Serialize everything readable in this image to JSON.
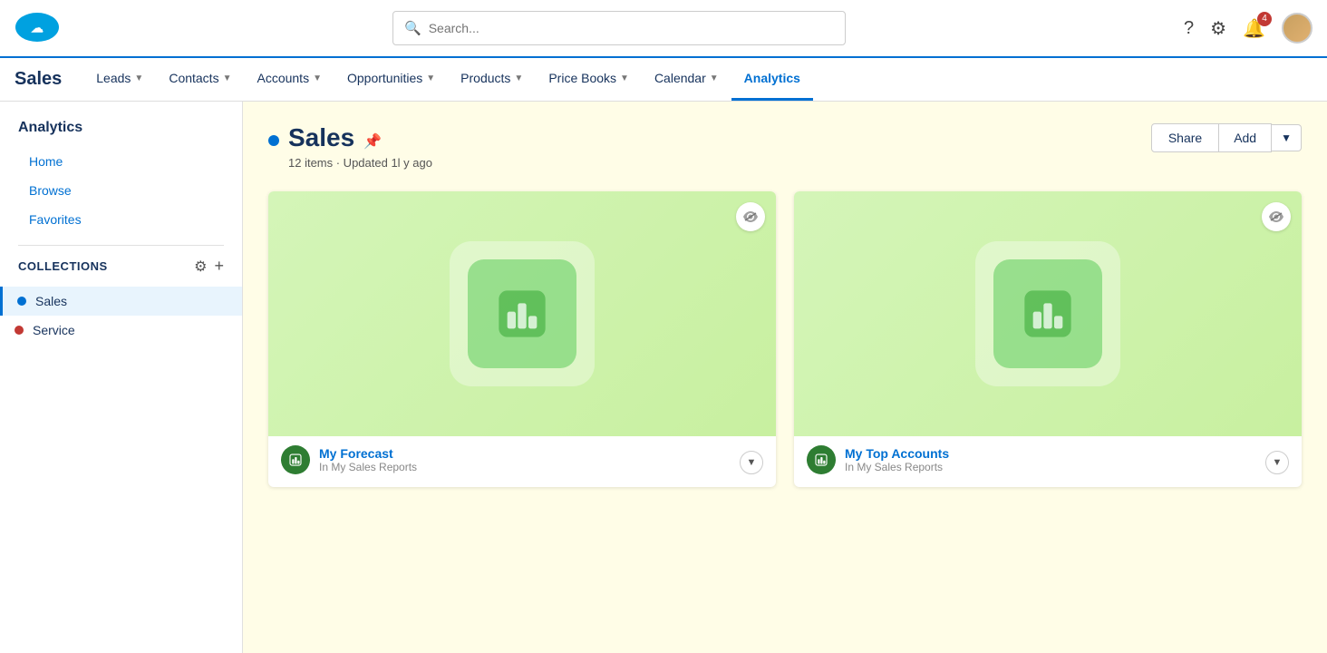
{
  "topbar": {
    "logo_alt": "Salesforce",
    "search_placeholder": "Search...",
    "help_icon": "?",
    "settings_icon": "⚙",
    "notifications_count": "4",
    "avatar_alt": "User Avatar"
  },
  "navbar": {
    "app_name": "Sales",
    "items": [
      {
        "label": "Leads",
        "active": false
      },
      {
        "label": "Contacts",
        "active": false
      },
      {
        "label": "Accounts",
        "active": false
      },
      {
        "label": "Opportunities",
        "active": false
      },
      {
        "label": "Products",
        "active": false
      },
      {
        "label": "Price Books",
        "active": false
      },
      {
        "label": "Calendar",
        "active": false
      },
      {
        "label": "Analytics",
        "active": true
      }
    ]
  },
  "sidebar": {
    "section_title": "Analytics",
    "nav_items": [
      {
        "label": "Home"
      },
      {
        "label": "Browse"
      },
      {
        "label": "Favorites"
      }
    ],
    "collections_title": "Collections",
    "collections": [
      {
        "label": "Sales",
        "color": "#0070d2",
        "active": true
      },
      {
        "label": "Service",
        "color": "#c23934",
        "active": false
      }
    ]
  },
  "content": {
    "title": "Sales",
    "subtitle": "12 items · Updated 1l y ago",
    "share_label": "Share",
    "add_label": "Add",
    "cards": [
      {
        "name": "My Forecast",
        "subtitle": "In My Sales Reports",
        "thumbnail_bg": "#d4f5b8"
      },
      {
        "name": "My Top Accounts",
        "subtitle": "In My Sales Reports",
        "thumbnail_bg": "#d4f5b8"
      }
    ]
  }
}
